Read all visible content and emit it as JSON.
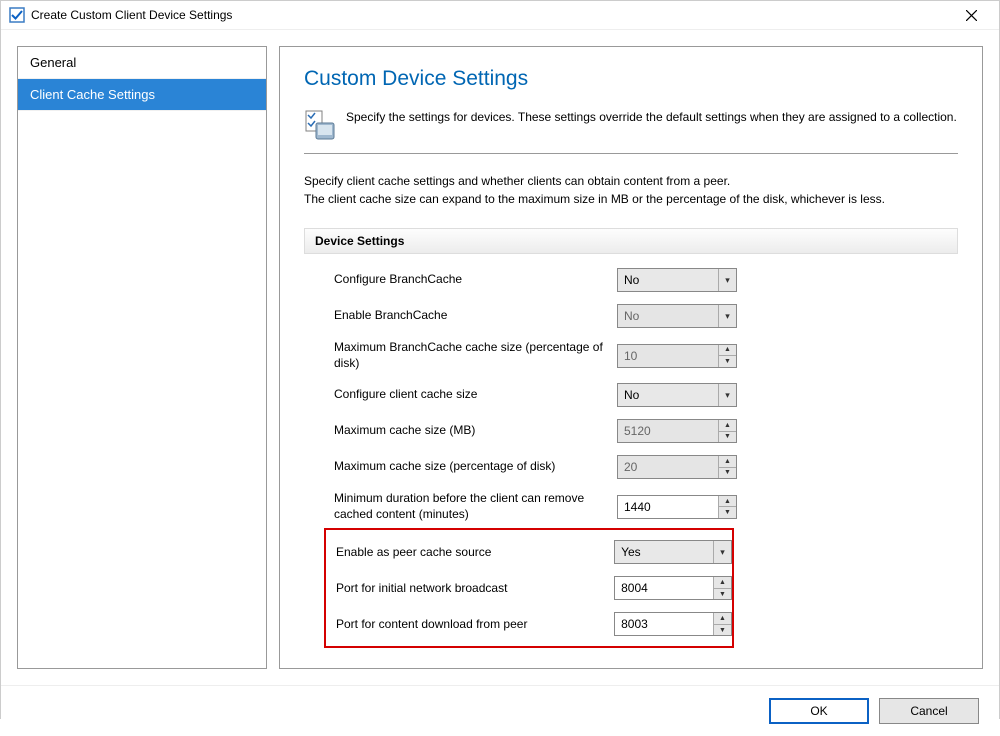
{
  "window": {
    "title": "Create Custom Client Device Settings"
  },
  "sidebar": {
    "items": [
      {
        "label": "General",
        "selected": false
      },
      {
        "label": "Client Cache Settings",
        "selected": true
      }
    ]
  },
  "main": {
    "title": "Custom Device Settings",
    "description": "Specify the settings for devices. These settings override the default settings when they are assigned to a collection.",
    "help_line1": "Specify client cache settings and whether clients can obtain content from a peer.",
    "help_line2": "The client cache size can expand to the maximum size in MB or the percentage of the disk, whichever is less.",
    "section_header": "Device Settings",
    "settings": [
      {
        "label": "Configure BranchCache",
        "value": "No",
        "type": "dropdown",
        "enabled": true,
        "highlighted": false
      },
      {
        "label": "Enable BranchCache",
        "value": "No",
        "type": "dropdown",
        "enabled": false,
        "highlighted": false
      },
      {
        "label": "Maximum BranchCache cache size (percentage of disk)",
        "value": "10",
        "type": "spinner",
        "enabled": false,
        "highlighted": false
      },
      {
        "label": "Configure client cache size",
        "value": "No",
        "type": "dropdown",
        "enabled": true,
        "highlighted": false
      },
      {
        "label": "Maximum cache size (MB)",
        "value": "5120",
        "type": "spinner",
        "enabled": false,
        "highlighted": false
      },
      {
        "label": "Maximum cache size (percentage of disk)",
        "value": "20",
        "type": "spinner",
        "enabled": false,
        "highlighted": false
      },
      {
        "label": "Minimum duration before the client can remove cached content (minutes)",
        "value": "1440",
        "type": "spinner",
        "enabled": true,
        "highlighted": false
      },
      {
        "label": "Enable as peer cache source",
        "value": "Yes",
        "type": "dropdown",
        "enabled": true,
        "highlighted": true
      },
      {
        "label": "Port for initial network broadcast",
        "value": "8004",
        "type": "spinner",
        "enabled": true,
        "highlighted": true
      },
      {
        "label": "Port for content download from peer",
        "value": "8003",
        "type": "spinner",
        "enabled": true,
        "highlighted": true
      }
    ]
  },
  "footer": {
    "ok": "OK",
    "cancel": "Cancel"
  }
}
